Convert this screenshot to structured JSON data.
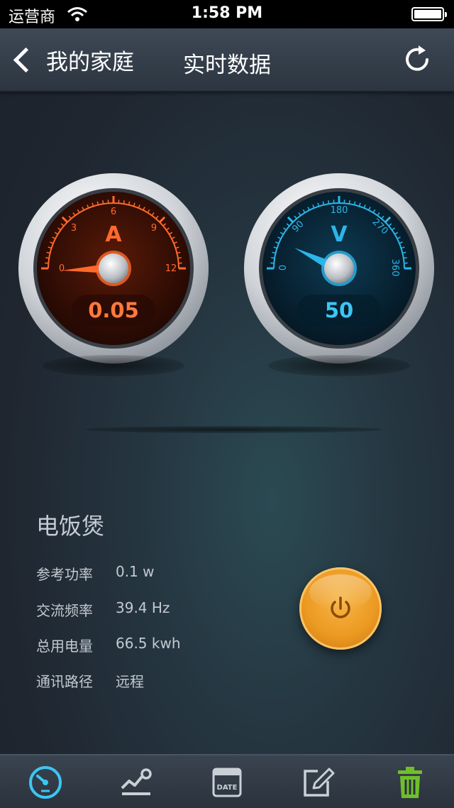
{
  "status_bar": {
    "carrier": "运营商",
    "time": "1:58 PM"
  },
  "nav": {
    "back_label": "我的家庭",
    "title": "实时数据"
  },
  "gauges": {
    "current": {
      "unit_letter": "A",
      "ticks": [
        "0",
        "3",
        "6",
        "9",
        "12"
      ],
      "readout": "0.05",
      "color": "#ff6a2a"
    },
    "voltage": {
      "unit_letter": "V",
      "ticks": [
        "0",
        "90",
        "180",
        "270",
        "360"
      ],
      "readout": "50",
      "color": "#2bb6ea"
    }
  },
  "device": {
    "name": "电饭煲",
    "rows": [
      {
        "label": "参考功率",
        "value": "0.1 w"
      },
      {
        "label": "交流频率",
        "value": "39.4 Hz"
      },
      {
        "label": "总用电量",
        "value": "66.5 kwh"
      },
      {
        "label": "通讯路径",
        "value": "远程"
      }
    ]
  },
  "tab_bar": {
    "tabs": [
      {
        "icon": "gauge-icon",
        "active": true
      },
      {
        "icon": "trend-chart-icon"
      },
      {
        "icon": "calendar-icon",
        "label": "DATE"
      },
      {
        "icon": "edit-icon"
      },
      {
        "icon": "trash-icon"
      }
    ],
    "active_color": "#3cc6f2",
    "trash_color": "#6fbf2a"
  }
}
